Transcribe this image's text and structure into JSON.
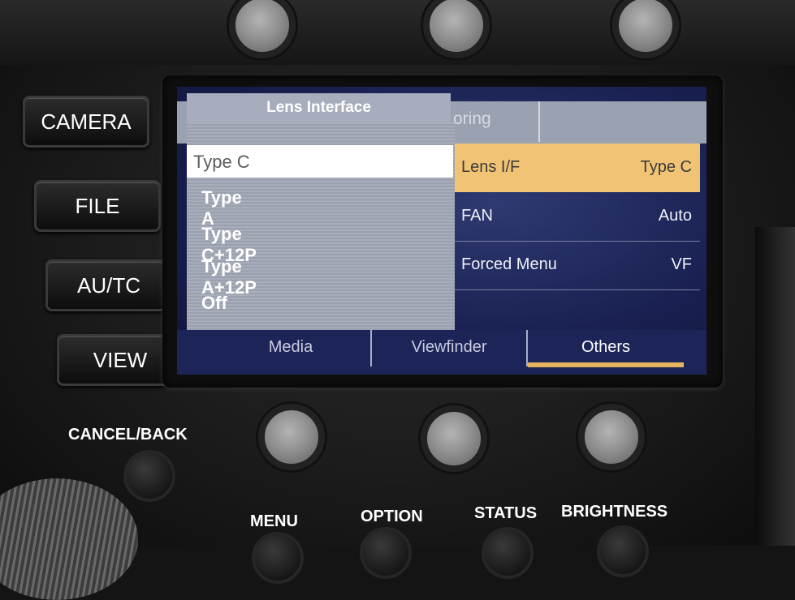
{
  "left_buttons": [
    "CAMERA",
    "FILE",
    "AU/TC",
    "VIEW"
  ],
  "screen": {
    "top_tab_partial": "oring",
    "settings": [
      {
        "label": "Lens I/F",
        "value": "Type C",
        "selected": true
      },
      {
        "label": "FAN",
        "value": "Auto",
        "selected": false
      },
      {
        "label": "Forced Menu",
        "value": "VF",
        "selected": false
      }
    ],
    "bottom_tabs": [
      {
        "label": "Media",
        "selected": false
      },
      {
        "label": "Viewfinder",
        "selected": false
      },
      {
        "label": "Others",
        "selected": true
      }
    ],
    "popup": {
      "title": "Lens Interface",
      "options": [
        "Type C",
        "Type A",
        "Type C+12P",
        "Type A+12P",
        "Off"
      ],
      "selected_index": 0
    }
  },
  "bottom_labels": {
    "cancel_back": "CANCEL/BACK",
    "menu": "MENU",
    "option": "OPTION",
    "status": "STATUS",
    "brightness": "BRIGHTNESS"
  },
  "colors": {
    "screen_blue": "#1a2152",
    "highlight_orange": "#f0c474",
    "popup_gray": "#a8adba"
  }
}
